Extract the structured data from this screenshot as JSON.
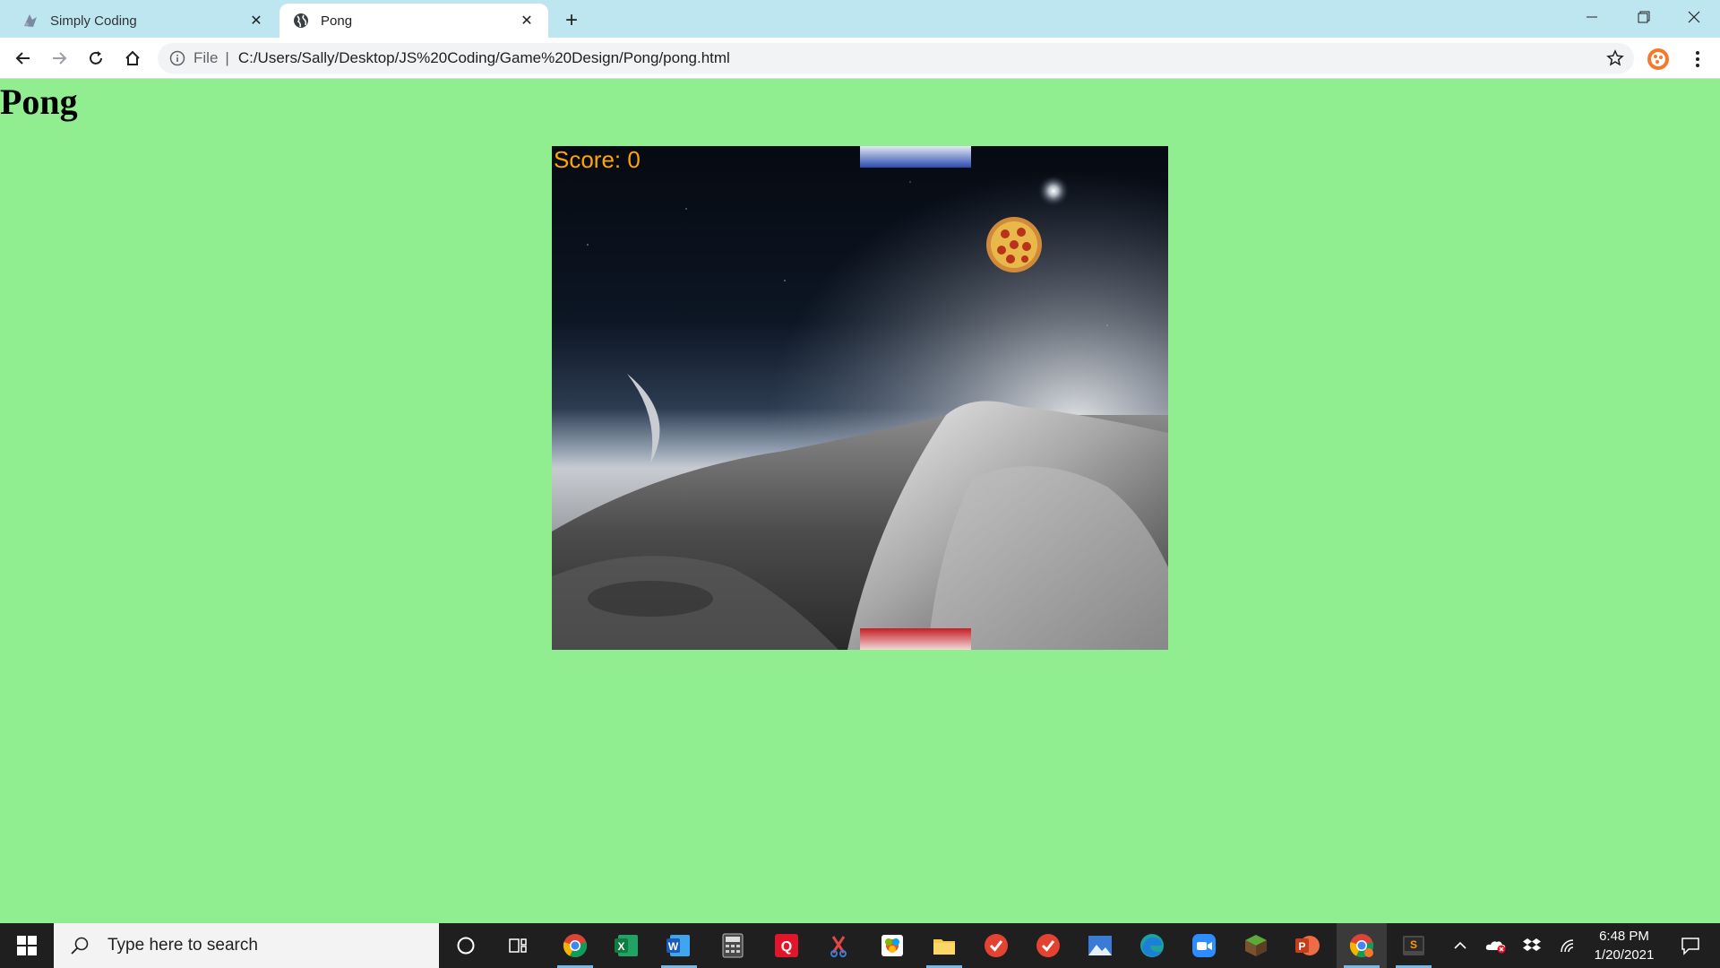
{
  "browser": {
    "tabs": [
      {
        "title": "Simply Coding",
        "favicon": "simply-coding-icon",
        "active": false
      },
      {
        "title": "Pong",
        "favicon": "globe-icon",
        "active": true
      }
    ],
    "new_tab_icon": "plus-icon",
    "window_controls": [
      "minimize-icon",
      "restore-icon",
      "close-icon"
    ],
    "address": {
      "scheme": "File",
      "url": "C:/Users/Sally/Desktop/JS%20Coding/Game%20Design/Pong/pong.html"
    },
    "nav_icons": [
      "back-arrow-icon",
      "forward-arrow-icon",
      "reload-icon",
      "home-icon"
    ]
  },
  "page": {
    "title": "Pong",
    "background_color": "#90ee90"
  },
  "game": {
    "score_label": "Score: 0",
    "score_color": "#ffa500",
    "background": "space-planet-scene",
    "ball": "pizza-ball",
    "top_paddle_color": "#2a4bb0",
    "bottom_paddle_color": "#c61e24"
  },
  "taskbar": {
    "search_placeholder": "Type here to search",
    "pinned_apps": [
      "cortana-icon",
      "task-view-icon",
      "chrome-icon",
      "excel-icon",
      "word-icon",
      "calculator-icon",
      "quicken-icon",
      "snipping-tool-icon",
      "photos-icon",
      "file-explorer-icon",
      "todoist-icon",
      "todoist-alt-icon",
      "photos-landscape-icon",
      "edge-icon",
      "zoom-icon",
      "minecraft-icon",
      "powerpoint-icon",
      "chrome-profile-icon",
      "sublime-text-icon"
    ],
    "tray_icons": [
      "chevron-up-icon",
      "onedrive-error-icon",
      "dropbox-icon",
      "wifi-icon"
    ],
    "clock": {
      "time": "6:48 PM",
      "date": "1/20/2021"
    }
  }
}
